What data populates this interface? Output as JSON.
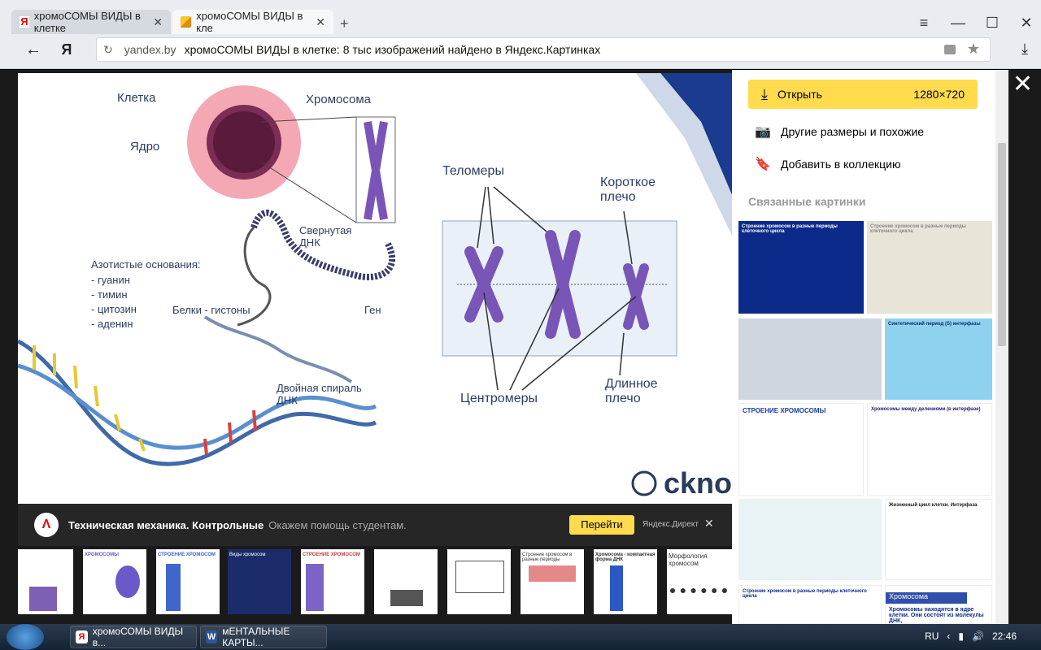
{
  "browser": {
    "tabs": [
      {
        "label": "хромоСОМЫ ВИДЫ в клетке",
        "icon": "yandex-icon"
      },
      {
        "label": "хромоСОМЫ ВИДЫ в кле",
        "icon": "image-icon"
      }
    ],
    "logo": "Я",
    "url_domain": "yandex.by",
    "url_title": "хромоСОМЫ ВИДЫ в клетке: 8 тыс изображений найдено в Яндекс.Картинках",
    "ya_tab_glyph": "Я"
  },
  "image": {
    "labels": {
      "cell": "Клетка",
      "nucleus": "Ядро",
      "chromosome": "Хромосома",
      "coiled_dna": "Свернутая\nДНК",
      "nitro_bases_title": "Азотистые основания:",
      "bases": [
        "- гуанин",
        "- тимин",
        "- цитозин",
        "- аденин"
      ],
      "histones": "Белки - гистоны",
      "gene": "Ген",
      "double_helix": "Двойная спираль\nДНК",
      "telomeres": "Теломеры",
      "short_arm": "Короткое\nплечо",
      "centromeres": "Центромеры",
      "long_arm": "Длинное\nплечо",
      "watermark": "ckno"
    }
  },
  "ad": {
    "logo": "Λ",
    "title": "Техническая механика. Контрольные",
    "subtitle": "Окажем помощь студентам.",
    "go_label": "Перейти",
    "direct_label": "Яндекс.Директ"
  },
  "thumbs": [
    {
      "caption": "",
      "color": "#7e5fb3"
    },
    {
      "caption": "ХРОМОСОМЫ",
      "color": "#6b59c9"
    },
    {
      "caption": "СТРОЕНИЕ ХРОМОСОМ",
      "color": "#3f66c9"
    },
    {
      "caption": "Виды хромосом",
      "color": "#1c2c6b"
    },
    {
      "caption": "СТРОЕНИЕ ХРОМОСОМ",
      "color": "#7b64c6"
    },
    {
      "caption": "",
      "color": "#666"
    },
    {
      "caption": "",
      "color": "#555"
    },
    {
      "caption": "Строение хромосом в разные периоды",
      "color": "#d03a3a"
    },
    {
      "caption": "Хромосома - компактная форма ДНК",
      "color": "#2b58c4"
    },
    {
      "caption": "Морфология хромосом",
      "color": "#333"
    }
  ],
  "sidebar": {
    "open_label": "Открыть",
    "open_size": "1280×720",
    "other_sizes": "Другие размеры и похожие",
    "add_collection": "Добавить в коллекцию",
    "related_heading": "Связанные картинки",
    "related": [
      {
        "caption": "Строение хромосом в разные периоды клеточного цикла",
        "bg": "#0c2a8a",
        "fg": "#ffffff"
      },
      {
        "caption": "Строение хромосом в разные периоды клеточного цикла",
        "bg": "#e8e4d8",
        "fg": "#888888"
      },
      {
        "caption": "",
        "bg": "#cfd6de",
        "fg": "#333333"
      },
      {
        "caption": "Синтетический период (S) интерфазы",
        "bg": "#8fd2f0",
        "fg": "#0a2a6b"
      },
      {
        "caption": "СТРОЕНИЕ ХРОМОСОМЫ",
        "bg": "#ffffff",
        "fg": "#1a3cb0"
      },
      {
        "caption": "Хромосомы между делениями (в интерфазе)",
        "bg": "#ffffff",
        "fg": "#1a1a6b"
      },
      {
        "caption": "",
        "bg": "#e9f2f5",
        "fg": "#333333"
      },
      {
        "caption": "Жизненный цикл клетки. Интерфаза",
        "bg": "#ffffff",
        "fg": "#1a1a1a"
      },
      {
        "caption": "Строение хромосом в разные периоды клеточного цикла",
        "bg": "#ffffff",
        "fg": "#0c2a8a"
      },
      {
        "caption": "Хромосома",
        "bg": "#2f4fa8",
        "fg": "#ffffff"
      }
    ],
    "related_note": "Хромосомы находятся в ядре клетки. Они состоят из молекулы ДНК,"
  },
  "taskbar": {
    "items": [
      {
        "label": "хромоСОМЫ ВИДЫ в...",
        "icon": "yandex-browser-icon"
      },
      {
        "label": "мЕНТАЛЬНЫЕ КАРТЫ...",
        "icon": "word-icon"
      }
    ],
    "tray_lang": "RU",
    "time": "22:46",
    "word_glyph": "W"
  },
  "colors": {
    "accent_yellow": "#ffdb4d",
    "chromosome_purple": "#7a55b8",
    "cell_pink": "#f4a8b4",
    "navy_stripe": "#1a3b8f"
  }
}
